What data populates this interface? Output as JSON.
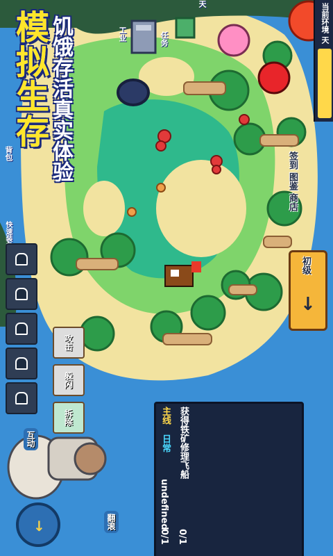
{
  "promo": {
    "title_main": "模拟生存",
    "title_sub": "饥饿存活真实体验"
  },
  "status": {
    "hint": "当前环境 天"
  },
  "top": {
    "area": "天",
    "task": "任务",
    "industry": "工业"
  },
  "left": {
    "top": "背包",
    "section": "快速装备"
  },
  "actions": {
    "attack": "攻击",
    "defense": "躲闪",
    "craft": "拆除",
    "interact": "互动",
    "roll": "翻滚"
  },
  "right": {
    "signin": "签到",
    "codex": "图鉴",
    "shop": "商店",
    "initial": "初级"
  },
  "quests": {
    "main_tag": "主线",
    "daily_tag": "日常",
    "main_text": "获得铁矿修理飞船",
    "main_progress": "0/1",
    "daily_text": "undefined",
    "daily_progress": "0/1"
  },
  "colors": {
    "ocean": "#3a8fd6",
    "title_yellow": "#ffe62a",
    "outline_blue": "#1b2a7a",
    "panel": "#18253f"
  }
}
